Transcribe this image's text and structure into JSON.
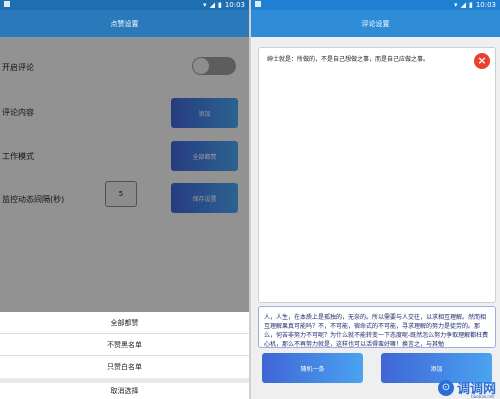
{
  "status_time": "10:03",
  "left": {
    "title": "点赞设置",
    "rows": [
      {
        "label": "开启评论"
      },
      {
        "label": "评论内容",
        "button": "添加"
      },
      {
        "label": "工作模式",
        "button": "全部都赞"
      },
      {
        "label": "监控动态间隔(秒)",
        "value": "5",
        "button": "保存设置"
      }
    ],
    "sheet": {
      "options": [
        "全部都赞",
        "不赞黑名单",
        "只赞白名单"
      ],
      "cancel": "取消选择"
    }
  },
  "right": {
    "title": "评论设置",
    "quote": "绅士就是：所做的，不是自己想做之事，而是自己应做之事。",
    "comment": "人，人生，在本质上是孤独的，无奈的。所以需要与人交往，以求相互理解。然而相互理解果真可能吗？不，不可能，宿命式的不可能，寻求理解的努力是徒劳的。那么，何苦非努力不可呢？为什么就不能转变一下态度呢-既然怎么努力争取理解都枉费心机，那么不再努力就是，这样也可以活得蛮好嘛！换言之，与其勉",
    "random_button": "随机一条",
    "add_button": "添加"
  },
  "watermark": {
    "logo_text": "⊙",
    "text": "调调网",
    "sub": "tiaotiao.net"
  },
  "colors": {
    "accent": "#2f8cd6",
    "button_start": "#3f66d6",
    "button_end": "#4aa3f0",
    "close": "#e8412f"
  },
  "icons": [
    "notification-icon",
    "wifi-icon",
    "signal-icon",
    "battery-icon",
    "close-icon",
    "watermark-logo-icon"
  ]
}
